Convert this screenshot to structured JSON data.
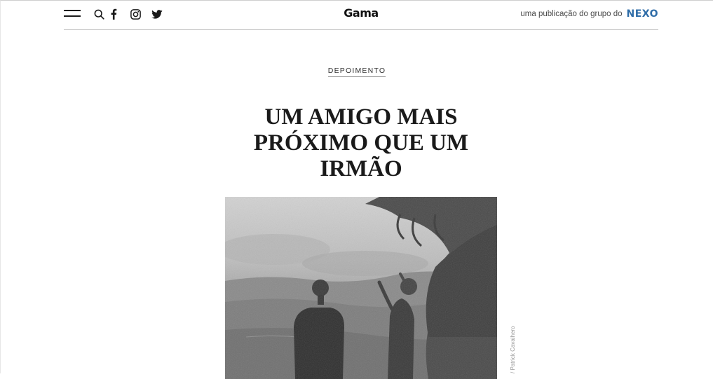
{
  "header": {
    "brand": "Gama",
    "publication_prefix": "uma publicação do grupo do",
    "publisher": "NEXO",
    "icons": [
      "menu-icon",
      "search-icon",
      "facebook-icon",
      "instagram-icon",
      "twitter-icon"
    ]
  },
  "article": {
    "category": "DEPOIMENTO",
    "title": "UM AMIGO MAIS PRÓXIMO QUE UM IRMÃO",
    "photo_credit": "/ Patrick Cavalhero"
  },
  "colors": {
    "text": "#1a1a1a",
    "nexo_blue": "#2f6da8",
    "nexo_teal": "#2aa6a0",
    "divider": "#bdbdbd"
  }
}
